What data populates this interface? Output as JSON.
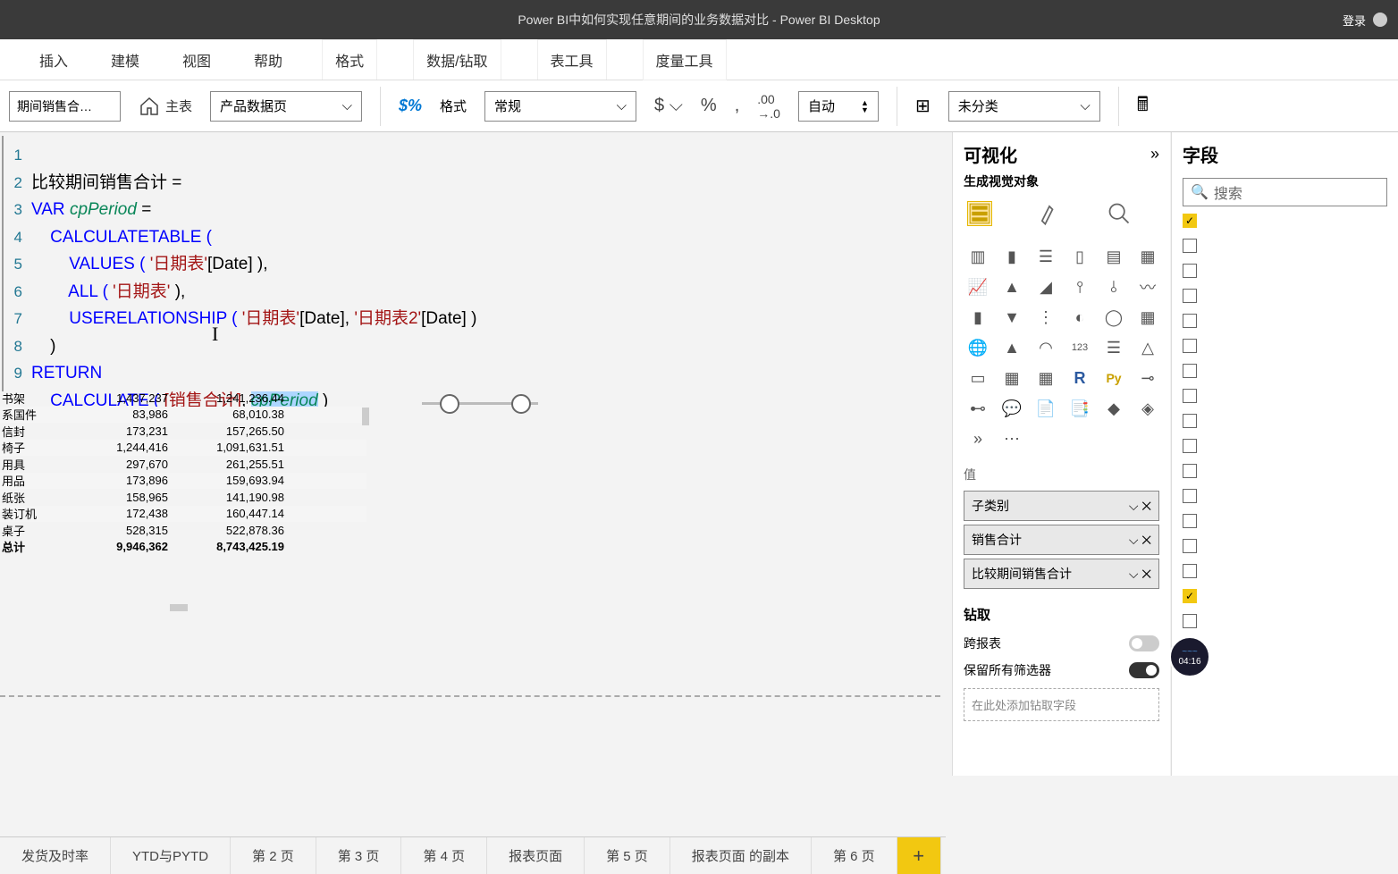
{
  "titlebar": {
    "title": "Power BI中如何实现任意期间的业务数据对比 - Power BI Desktop",
    "login": "登录"
  },
  "ribbon": {
    "tabs": [
      "插入",
      "建模",
      "视图",
      "帮助"
    ],
    "ctx_tabs": [
      "格式",
      "数据/钻取",
      "表工具",
      "度量工具"
    ],
    "active_ctx": "度量工具"
  },
  "toolbar": {
    "measure_name": "期间销售合…",
    "home": "主表",
    "table_select": "产品数据页",
    "format_label": "格式",
    "format_select": "常规",
    "decimals": "自动",
    "category": "未分类"
  },
  "dax": {
    "lines": [
      "1",
      "2",
      "3",
      "4",
      "5",
      "6",
      "7",
      "8",
      "9"
    ],
    "l1_measure": "比较期间销售合计",
    "l1_eq": " = ",
    "l2_var": "VAR ",
    "l2_name": "cpPeriod",
    "l2_eq": " = ",
    "l3": "    CALCULATETABLE (",
    "l4_pre": "        VALUES ( ",
    "l4_str": "'日期表'",
    "l4_post": "[Date] ),",
    "l5_pre": "        ALL ( ",
    "l5_str": "'日期表'",
    "l5_post": " ),",
    "l6_pre": "        USERELATIONSHIP ( ",
    "l6_s1": "'日期表'",
    "l6_mid": "[Date], ",
    "l6_s2": "'日期表2'",
    "l6_post": "[Date] )",
    "l7": "    )",
    "l8": "RETURN",
    "l9_pre": "    CALCULATE ( ",
    "l9_meas": "[销售合计]",
    "l9_mid": ", ",
    "l9_hl": "cpPeriod",
    "l9_post": " )"
  },
  "table_rows": [
    {
      "c1": "书架",
      "c2": "1,437,237",
      "c3": "1,241,236.44"
    },
    {
      "c1": "系国件",
      "c2": "83,986",
      "c3": "68,010.38"
    },
    {
      "c1": "信封",
      "c2": "173,231",
      "c3": "157,265.50"
    },
    {
      "c1": "椅子",
      "c2": "1,244,416",
      "c3": "1,091,631.51"
    },
    {
      "c1": "用具",
      "c2": "297,670",
      "c3": "261,255.51"
    },
    {
      "c1": "用品",
      "c2": "173,896",
      "c3": "159,693.94"
    },
    {
      "c1": "纸张",
      "c2": "158,965",
      "c3": "141,190.98"
    },
    {
      "c1": "装订机",
      "c2": "172,438",
      "c3": "160,447.14"
    },
    {
      "c1": "桌子",
      "c2": "528,315",
      "c3": "522,878.36"
    },
    {
      "c1": "总计",
      "c2": "9,946,362",
      "c3": "8,743,425.19"
    }
  ],
  "viz": {
    "title": "可视化",
    "subtitle": "生成视觉对象",
    "values_label": "值",
    "fields": [
      "子类别",
      "销售合计",
      "比较期间销售合计"
    ],
    "drill_title": "钻取",
    "cross_report": "跨报表",
    "keep_filters": "保留所有筛选器",
    "drill_well": "在此处添加钻取字段"
  },
  "fields_pane": {
    "title": "字段",
    "search": "搜索"
  },
  "pages": [
    "发货及时率",
    "YTD与PYTD",
    "第 2 页",
    "第 3 页",
    "第 4 页",
    "报表页面",
    "第 5 页",
    "报表页面 的副本",
    "第 6 页"
  ],
  "timer": "04:16"
}
